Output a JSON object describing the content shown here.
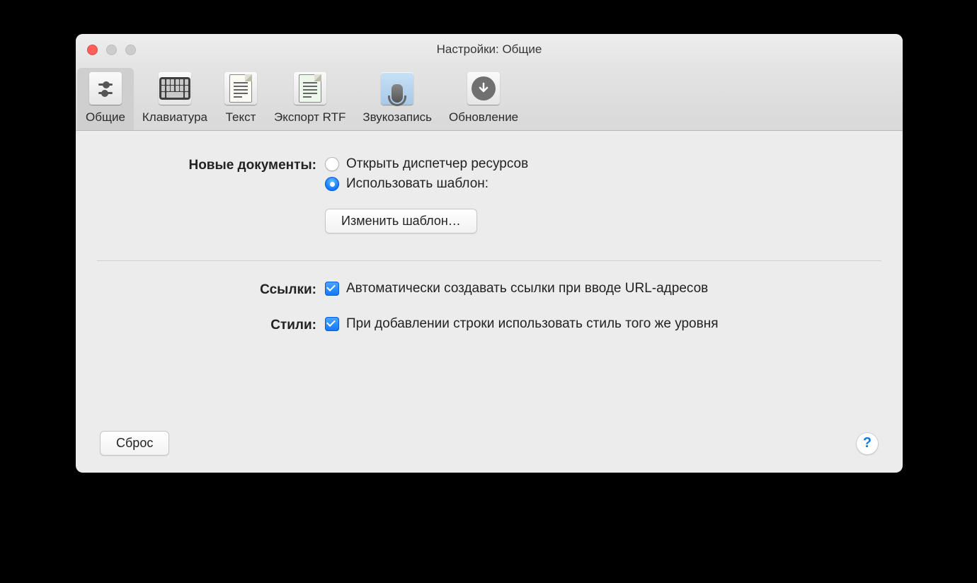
{
  "window": {
    "title": "Настройки: Общие"
  },
  "toolbar": {
    "items": [
      {
        "id": "general",
        "label": "Общие",
        "selected": true
      },
      {
        "id": "keyboard",
        "label": "Клавиатура",
        "selected": false
      },
      {
        "id": "text",
        "label": "Текст",
        "selected": false
      },
      {
        "id": "rtf",
        "label": "Экспорт RTF",
        "selected": false
      },
      {
        "id": "audio",
        "label": "Звукозапись",
        "selected": false
      },
      {
        "id": "update",
        "label": "Обновление",
        "selected": false
      }
    ]
  },
  "sections": {
    "newDocuments": {
      "label": "Новые документы:",
      "options": [
        {
          "id": "open-manager",
          "label": "Открыть диспетчер ресурсов",
          "selected": false
        },
        {
          "id": "use-template",
          "label": "Использовать шаблон:",
          "selected": true
        }
      ],
      "changeTemplateButton": "Изменить шаблон…"
    },
    "links": {
      "label": "Ссылки:",
      "checkbox": {
        "label": "Автоматически создавать ссылки при вводе URL-адресов",
        "checked": true
      }
    },
    "styles": {
      "label": "Стили:",
      "checkbox": {
        "label": "При добавлении строки использовать стиль того же уровня",
        "checked": true
      }
    }
  },
  "footer": {
    "resetButton": "Сброс",
    "helpGlyph": "?"
  }
}
